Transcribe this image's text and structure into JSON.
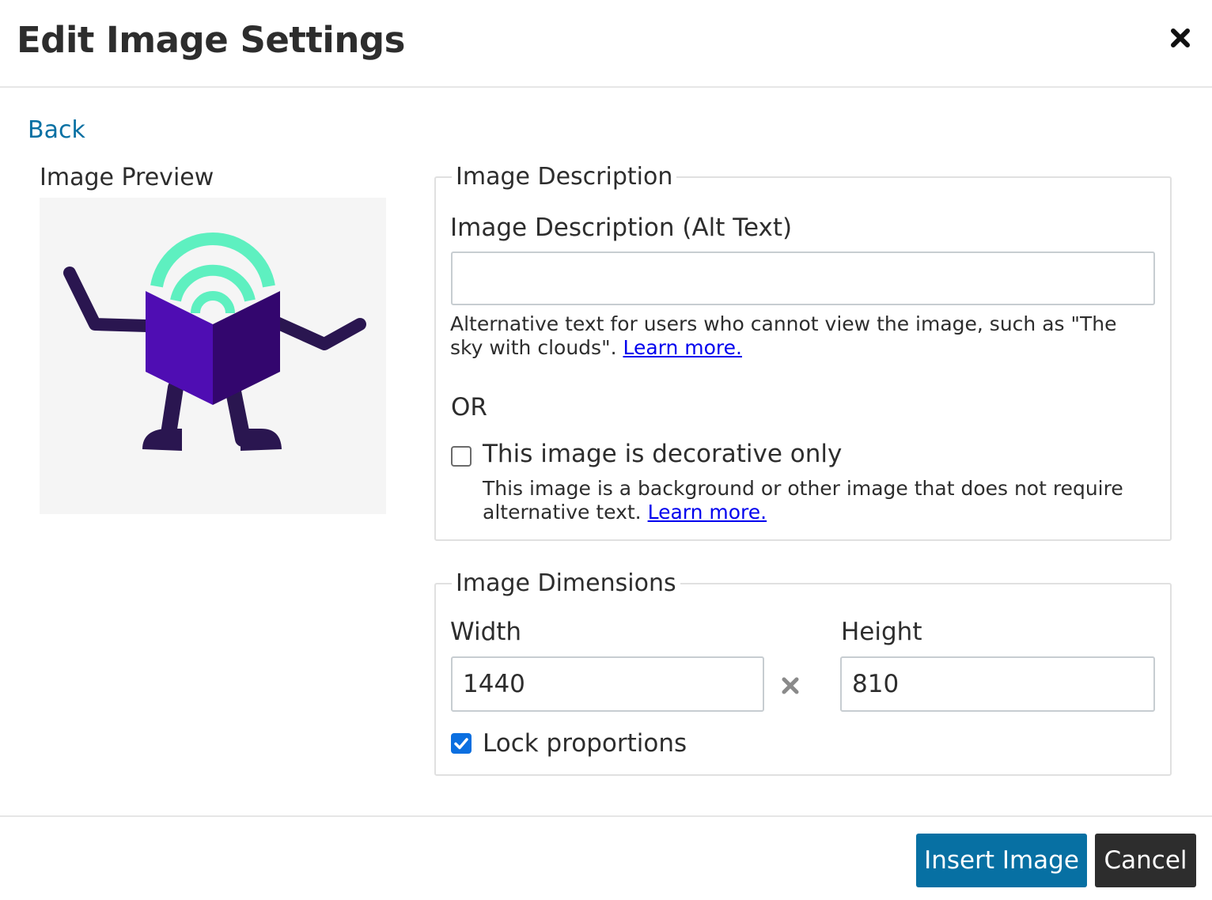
{
  "dialog": {
    "title": "Edit Image Settings",
    "close_icon": "close-icon",
    "back_label": "Back"
  },
  "preview": {
    "label": "Image Preview",
    "image_icon": "book-robot-illustration"
  },
  "description": {
    "legend": "Image Description",
    "alt_label": "Image Description (Alt Text)",
    "alt_value": "",
    "alt_hint": "Alternative text for users who cannot view the image, such as \"The sky with clouds\".",
    "alt_learn_more": "Learn more.",
    "or_label": "OR",
    "decorative_label": "This image is decorative only",
    "decorative_checked": false,
    "decorative_hint": "This image is a background or other image that does not require alternative text.",
    "decorative_learn_more": "Learn more."
  },
  "dimensions": {
    "legend": "Image Dimensions",
    "width_label": "Width",
    "width_value": "1440",
    "height_label": "Height",
    "height_value": "810",
    "lock_label": "Lock proportions",
    "lock_checked": true
  },
  "footer": {
    "insert_label": "Insert Image",
    "cancel_label": "Cancel"
  },
  "colors": {
    "primary": "#0770a3",
    "secondary": "#2d2d2d",
    "link": "#0000ee",
    "checkbox_checked": "#0b6fe0"
  }
}
